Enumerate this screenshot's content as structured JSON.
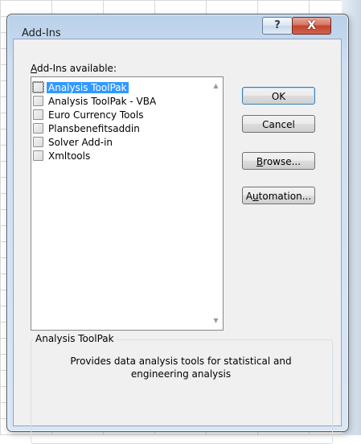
{
  "dialog": {
    "title": "Add-Ins",
    "help_glyph": "?",
    "close_glyph": "X",
    "available_label_mnemonic": "A",
    "available_label_rest": "dd-Ins available:"
  },
  "addins": [
    {
      "label": "Analysis ToolPak",
      "checked": false,
      "selected": true
    },
    {
      "label": "Analysis ToolPak - VBA",
      "checked": false,
      "selected": false
    },
    {
      "label": "Euro Currency Tools",
      "checked": false,
      "selected": false
    },
    {
      "label": "Plansbenefitsaddin",
      "checked": false,
      "selected": false
    },
    {
      "label": "Solver Add-in",
      "checked": false,
      "selected": false
    },
    {
      "label": "Xmltools",
      "checked": false,
      "selected": false
    }
  ],
  "buttons": {
    "ok": "OK",
    "cancel": "Cancel",
    "browse_mnemonic": "B",
    "browse_rest": "rowse...",
    "automation_pre": "A",
    "automation_mnemonic": "u",
    "automation_rest": "tomation..."
  },
  "description": {
    "title": "Analysis ToolPak",
    "text": "Provides data analysis tools for statistical and engineering analysis"
  },
  "scroll": {
    "up_glyph": "▲",
    "down_glyph": "▼"
  }
}
